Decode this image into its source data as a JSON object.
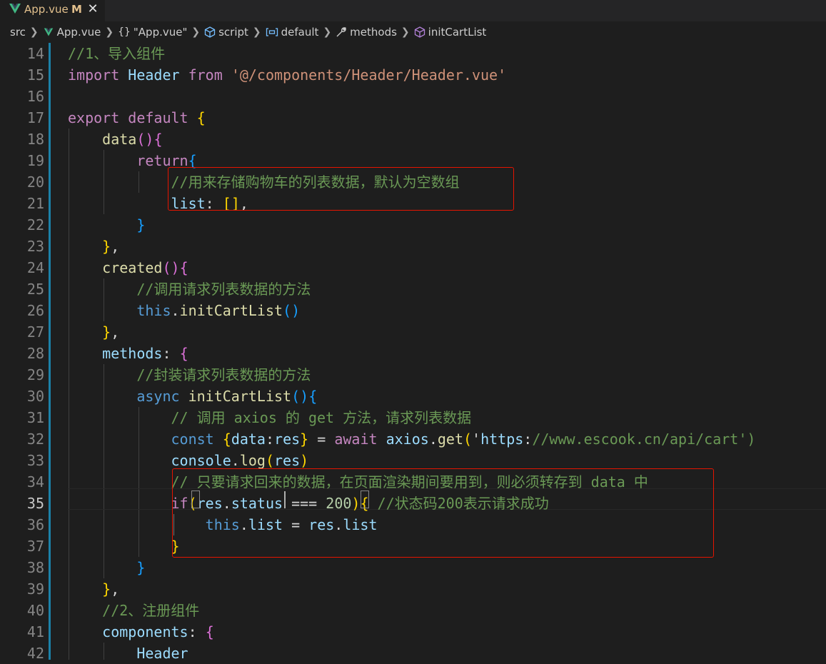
{
  "tab": {
    "icon": "vue-icon",
    "title": "App.vue",
    "status": "M",
    "close": "✕"
  },
  "breadcrumbs": [
    {
      "icon": "",
      "label": "src"
    },
    {
      "icon": "vue-icon",
      "label": "App.vue"
    },
    {
      "icon": "braces-icon",
      "label": "\"App.vue\""
    },
    {
      "icon": "cube-icon",
      "label": "script"
    },
    {
      "icon": "variable-icon",
      "label": "default"
    },
    {
      "icon": "wrench-icon",
      "label": "methods"
    },
    {
      "icon": "cube-icon",
      "label": "initCartList"
    }
  ],
  "editor": {
    "active_line": 35,
    "lines": [
      {
        "n": 14,
        "text": "//1、导入组件"
      },
      {
        "n": 15,
        "text": "import Header from '@/components/Header/Header.vue'"
      },
      {
        "n": 16,
        "text": ""
      },
      {
        "n": 17,
        "text": "export default {"
      },
      {
        "n": 18,
        "text": "    data(){"
      },
      {
        "n": 19,
        "text": "        return{"
      },
      {
        "n": 20,
        "text": "            //用来存储购物车的列表数据，默认为空数组"
      },
      {
        "n": 21,
        "text": "            list: [],"
      },
      {
        "n": 22,
        "text": "        }"
      },
      {
        "n": 23,
        "text": "    },"
      },
      {
        "n": 24,
        "text": "    created(){"
      },
      {
        "n": 25,
        "text": "        //调用请求列表数据的方法"
      },
      {
        "n": 26,
        "text": "        this.initCartList()"
      },
      {
        "n": 27,
        "text": "    },"
      },
      {
        "n": 28,
        "text": "    methods: {"
      },
      {
        "n": 29,
        "text": "        //封装请求列表数据的方法"
      },
      {
        "n": 30,
        "text": "        async initCartList(){"
      },
      {
        "n": 31,
        "text": "            // 调用 axios 的 get 方法，请求列表数据"
      },
      {
        "n": 32,
        "text": "            const {data:res} = await axios.get('https://www.escook.cn/api/cart')"
      },
      {
        "n": 33,
        "text": "            console.log(res)"
      },
      {
        "n": 34,
        "text": "            // 只要请求回来的数据，在页面渲染期间要用到，则必须转存到 data 中"
      },
      {
        "n": 35,
        "text": "            if(res.status === 200){ //状态码200表示请求成功"
      },
      {
        "n": 36,
        "text": "                this.list = res.list"
      },
      {
        "n": 37,
        "text": "            }"
      },
      {
        "n": 38,
        "text": "        }"
      },
      {
        "n": 39,
        "text": "    },"
      },
      {
        "n": 40,
        "text": "    //2、注册组件"
      },
      {
        "n": 41,
        "text": "    components: {"
      },
      {
        "n": 42,
        "text": "        Header"
      }
    ]
  }
}
